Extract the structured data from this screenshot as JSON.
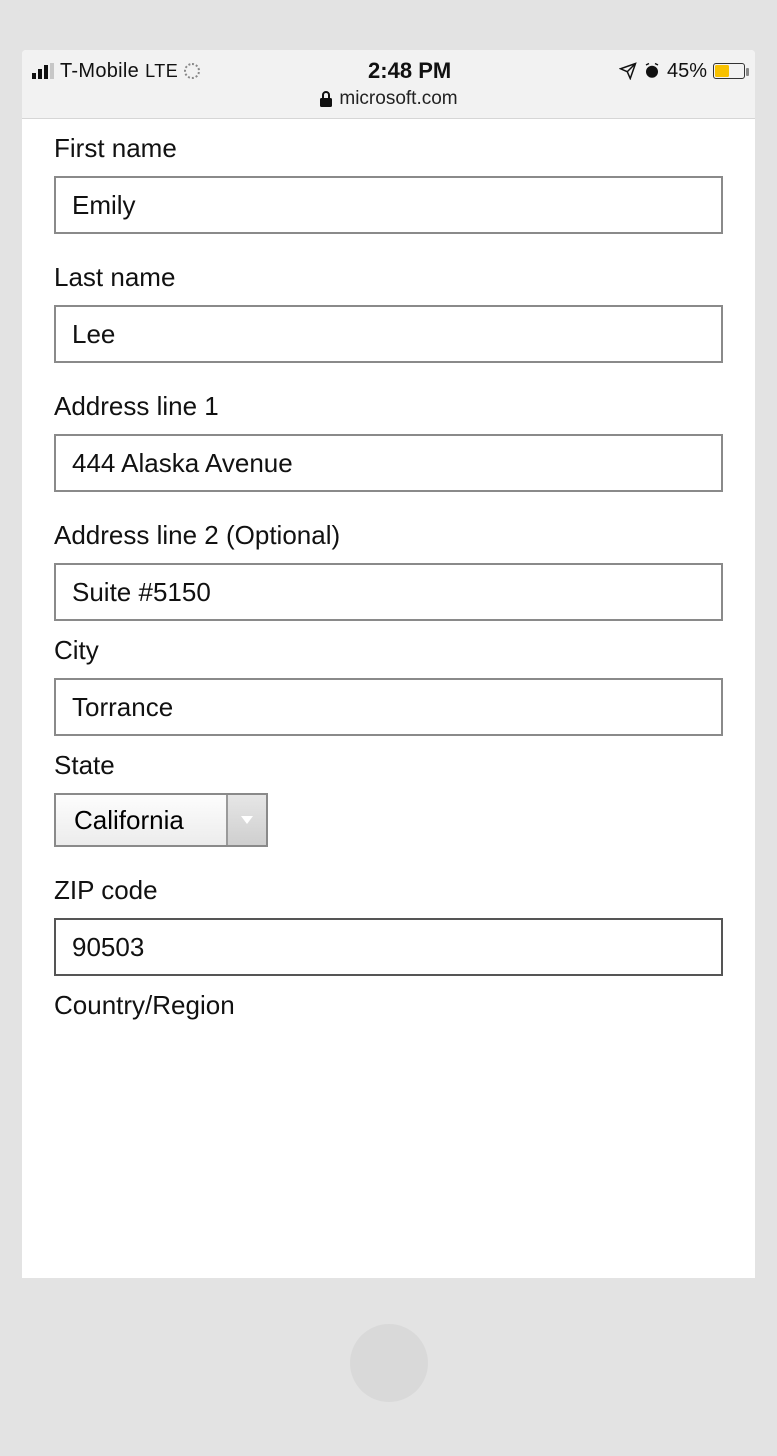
{
  "status": {
    "carrier": "T-Mobile",
    "network": "LTE",
    "time": "2:48 PM",
    "battery_pct": "45%",
    "url": "microsoft.com"
  },
  "form": {
    "first_name": {
      "label": "First name",
      "value": "Emily"
    },
    "last_name": {
      "label": "Last name",
      "value": "Lee"
    },
    "address1": {
      "label": "Address line 1",
      "value": "444 Alaska Avenue"
    },
    "address2": {
      "label": "Address line 2 (Optional)",
      "value": "Suite #5150"
    },
    "city": {
      "label": "City",
      "value": "Torrance"
    },
    "state": {
      "label": "State",
      "value": "California"
    },
    "zip": {
      "label": "ZIP code",
      "value": "90503"
    },
    "country": {
      "label": "Country/Region"
    }
  }
}
